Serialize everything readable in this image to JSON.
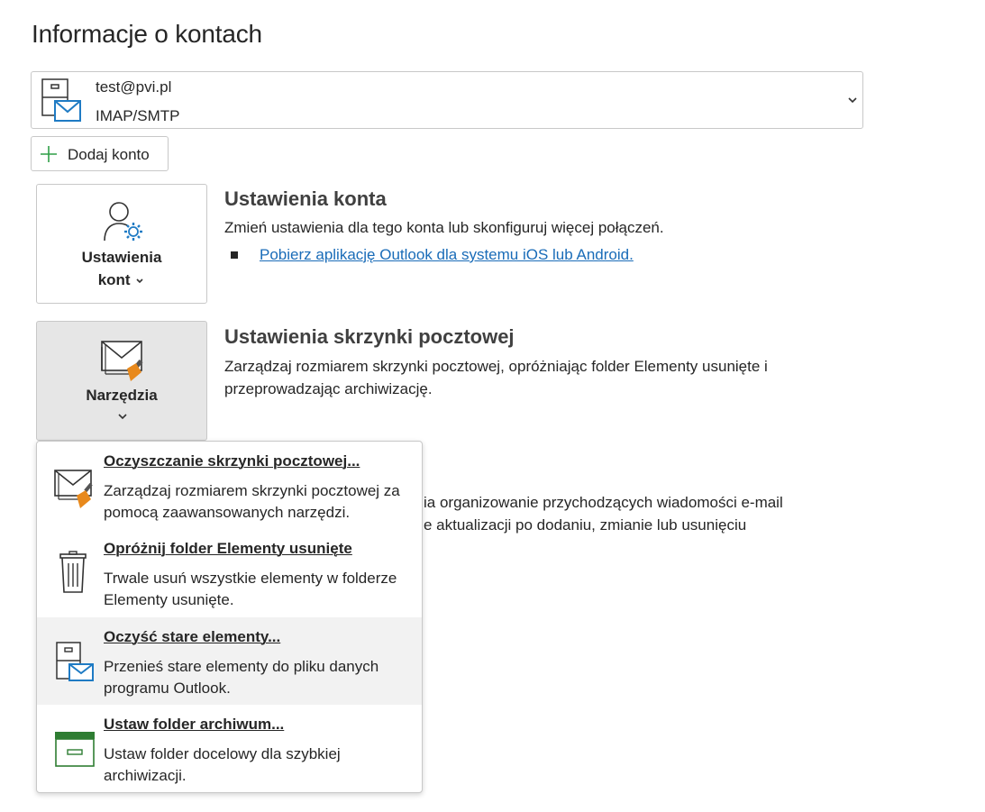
{
  "page": {
    "title": "Informacje o kontach"
  },
  "account": {
    "email": "test@pvi.pl",
    "type": "IMAP/SMTP",
    "icon": "account-mailbox-icon"
  },
  "add_account": {
    "label": "Dodaj konto",
    "icon": "plus-icon"
  },
  "account_settings": {
    "tile_label_line1": "Ustawienia",
    "tile_label_line2": "kont",
    "title": "Ustawienia konta",
    "description": "Zmień ustawienia dla tego konta lub skonfiguruj więcej połączeń.",
    "link": "Pobierz aplikację Outlook dla systemu iOS lub Android."
  },
  "mailbox_settings": {
    "tile_label": "Narzędzia",
    "title": "Ustawienia skrzynki pocztowej",
    "description": "Zarządzaj rozmiarem skrzynki pocztowej, opróżniając folder Elementy usunięte i przeprowadzając archiwizację."
  },
  "rules_partial": {
    "line1": "ia organizowanie przychodzących wiadomości e-mail",
    "line2": "e aktualizacji po dodaniu, zmianie lub usunięciu"
  },
  "tools_menu": {
    "items": [
      {
        "title": "Oczyszczanie skrzynki pocztowej...",
        "description": "Zarządzaj rozmiarem skrzynki pocztowej za pomocą zaawansowanych narzędzi.",
        "icon": "mailbox-cleanup-icon"
      },
      {
        "title": "Opróżnij folder Elementy usunięte",
        "description": "Trwale usuń wszystkie elementy w folderze Elementy usunięte.",
        "icon": "trash-icon"
      },
      {
        "title": "Oczyść stare elementy...",
        "description": "Przenieś stare elementy do pliku danych programu Outlook.",
        "icon": "archive-cabinet-icon"
      },
      {
        "title": "Ustaw folder archiwum...",
        "description": "Ustaw folder docelowy dla szybkiej archiwizacji.",
        "icon": "archive-folder-icon"
      }
    ]
  },
  "colors": {
    "link": "#1a6cb8",
    "accent_blue": "#1f7bc4",
    "accent_green": "#2e7d32",
    "accent_orange": "#e8891c"
  }
}
